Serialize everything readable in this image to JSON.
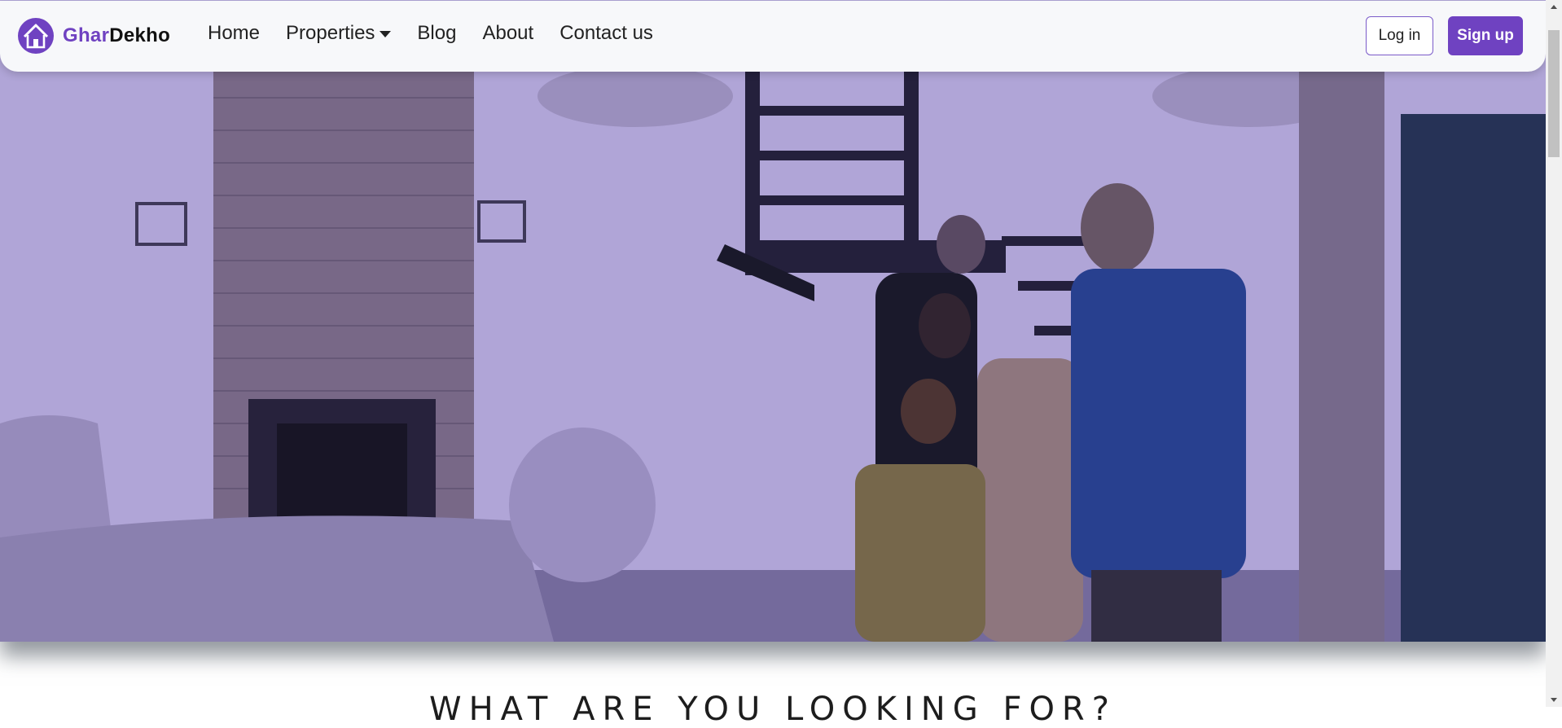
{
  "brand": {
    "part1": "Ghar",
    "part2": "Dekho",
    "logo_icon": "house-icon",
    "accent": "#6f42c1"
  },
  "nav": {
    "items": [
      {
        "label": "Home"
      },
      {
        "label": "Properties",
        "dropdown": true
      },
      {
        "label": "Blog"
      },
      {
        "label": "About"
      },
      {
        "label": "Contact us"
      }
    ]
  },
  "auth": {
    "login": "Log in",
    "signup": "Sign up"
  },
  "hero": {
    "image": "family-touring-house-with-realtor-photo"
  },
  "section": {
    "title": "WHAT ARE YOU LOOKING FOR?"
  }
}
